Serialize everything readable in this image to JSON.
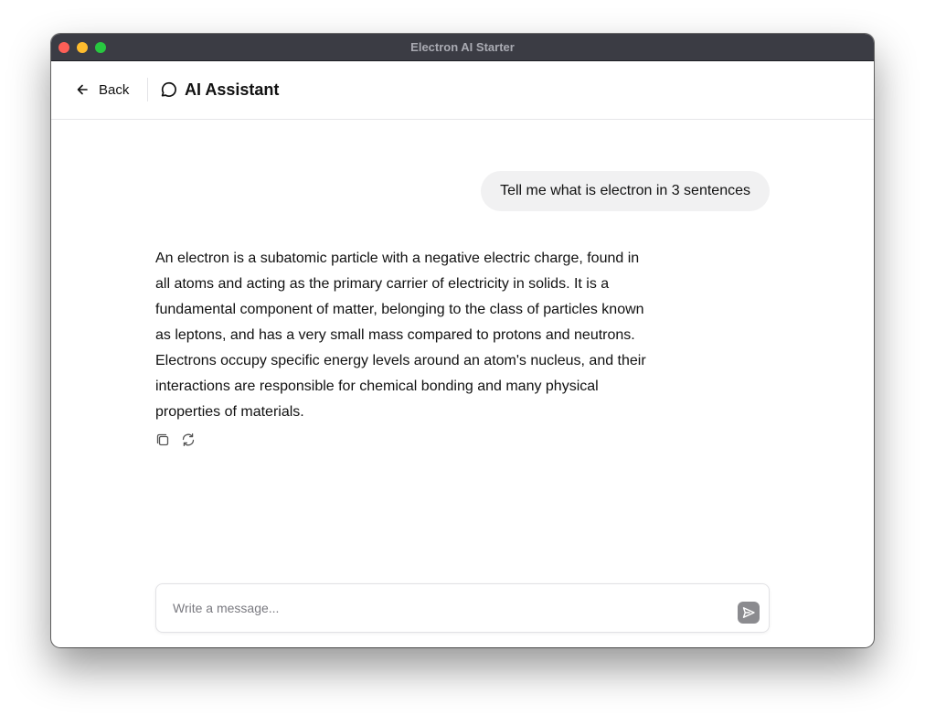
{
  "window": {
    "title": "Electron AI Starter"
  },
  "header": {
    "back_label": "Back",
    "title": "AI Assistant"
  },
  "messages": [
    {
      "role": "user",
      "text": "Tell me what is electron in 3 sentences"
    },
    {
      "role": "assistant",
      "text": "An electron is a subatomic particle with a negative electric charge, found in all atoms and acting as the primary carrier of electricity in solids. It is a fundamental component of matter, belonging to the class of particles known as leptons, and has a very small mass compared to protons and neutrons. Electrons occupy specific energy levels around an atom's nucleus, and their interactions are responsible for chemical bonding and many physical properties of materials."
    }
  ],
  "message_actions": {
    "icons": [
      "copy-icon",
      "regenerate-icon"
    ]
  },
  "composer": {
    "placeholder": "Write a message...",
    "value": "",
    "send_icon": "send-icon"
  },
  "colors": {
    "titlebar": "#3b3c44",
    "user_bubble": "#f1f1f2",
    "send_button": "#8b8b8f"
  }
}
